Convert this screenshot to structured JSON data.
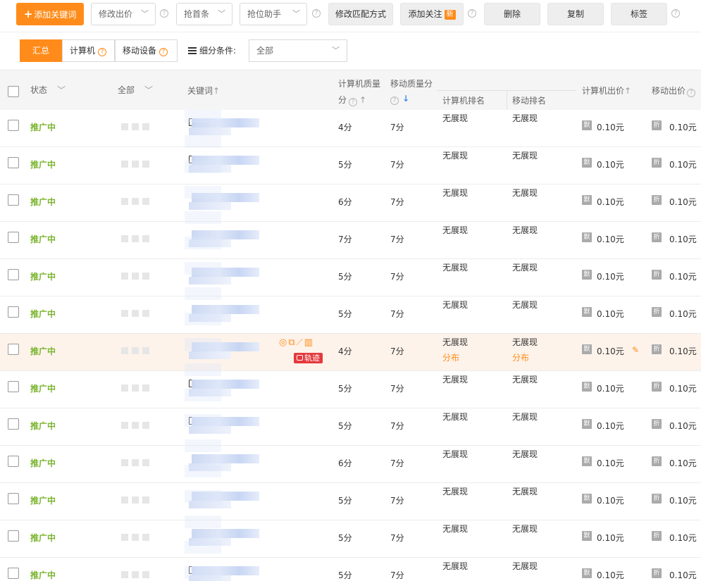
{
  "toolbar": {
    "add_keyword": "添加关键词",
    "modify_bid": "修改出价",
    "grab_top": "抢首条",
    "grab_assistant": "抢位助手",
    "modify_match": "修改匹配方式",
    "add_follow": "添加关注",
    "new_badge": "新",
    "delete": "删除",
    "copy": "复制",
    "tag": "标签",
    "help_glyph": "?"
  },
  "filter": {
    "tabs": [
      "汇总",
      "计算机",
      "移动设备"
    ],
    "condition_label": "细分条件:",
    "condition_value": "全部"
  },
  "header": {
    "status": "状态",
    "all": "全部",
    "keyword": "关键词",
    "pc_quality_line1": "计算机质量",
    "pc_quality_line2": "分",
    "mobile_quality": "移动质量分",
    "pc_rank": "计算机排名",
    "mobile_rank": "移动排名",
    "pc_bid": "计算机出价",
    "mobile_bid": "移动出价",
    "arrow_up": "↑",
    "arrow_down": "↓"
  },
  "rows": [
    {
      "status": "推广中",
      "pc_q": "4分",
      "m_q": "7分",
      "pc_rank": "无展现",
      "m_rank": "无展现",
      "pc_bid": "0.10元",
      "m_bid": "0.10元"
    },
    {
      "status": "推广中",
      "pc_q": "5分",
      "m_q": "7分",
      "pc_rank": "无展现",
      "m_rank": "无展现",
      "pc_bid": "0.10元",
      "m_bid": "0.10元"
    },
    {
      "status": "推广中",
      "pc_q": "6分",
      "m_q": "7分",
      "pc_rank": "无展现",
      "m_rank": "无展现",
      "pc_bid": "0.10元",
      "m_bid": "0.10元"
    },
    {
      "status": "推广中",
      "pc_q": "7分",
      "m_q": "7分",
      "pc_rank": "无展现",
      "m_rank": "无展现",
      "pc_bid": "0.10元",
      "m_bid": "0.10元"
    },
    {
      "status": "推广中",
      "pc_q": "5分",
      "m_q": "7分",
      "pc_rank": "无展现",
      "m_rank": "无展现",
      "pc_bid": "0.10元",
      "m_bid": "0.10元"
    },
    {
      "status": "推广中",
      "pc_q": "5分",
      "m_q": "7分",
      "pc_rank": "无展现",
      "m_rank": "无展现",
      "pc_bid": "0.10元",
      "m_bid": "0.10元"
    },
    {
      "status": "推广中",
      "pc_q": "4分",
      "m_q": "7分",
      "pc_rank": "无展现",
      "m_rank": "无展现",
      "pc_bid": "0.10元",
      "m_bid": "0.10元",
      "pc_dist": "分布",
      "m_dist": "分布",
      "track": "轨迹"
    },
    {
      "status": "推广中",
      "pc_q": "5分",
      "m_q": "7分",
      "pc_rank": "无展现",
      "m_rank": "无展现",
      "pc_bid": "0.10元",
      "m_bid": "0.10元"
    },
    {
      "status": "推广中",
      "pc_q": "5分",
      "m_q": "7分",
      "pc_rank": "无展现",
      "m_rank": "无展现",
      "pc_bid": "0.10元",
      "m_bid": "0.10元"
    },
    {
      "status": "推广中",
      "pc_q": "6分",
      "m_q": "7分",
      "pc_rank": "无展现",
      "m_rank": "无展现",
      "pc_bid": "0.10元",
      "m_bid": "0.10元"
    },
    {
      "status": "推广中",
      "pc_q": "5分",
      "m_q": "7分",
      "pc_rank": "无展现",
      "m_rank": "无展现",
      "pc_bid": "0.10元",
      "m_bid": "0.10元"
    },
    {
      "status": "推广中",
      "pc_q": "5分",
      "m_q": "7分",
      "pc_rank": "无展现",
      "m_rank": "无展现",
      "pc_bid": "0.10元",
      "m_bid": "0.10元"
    },
    {
      "status": "推广中",
      "pc_q": "5分",
      "m_q": "7分",
      "pc_rank": "无展现",
      "m_rank": "无展现",
      "pc_bid": "0.10元",
      "m_bid": "0.10元"
    }
  ],
  "icons": {
    "pc_tag": "默",
    "m_tag": "折"
  },
  "colors": {
    "accent": "#ff8c1a",
    "status_green": "#7ab42e",
    "track_red": "#e4393c",
    "sort_blue": "#3a8ee6"
  }
}
